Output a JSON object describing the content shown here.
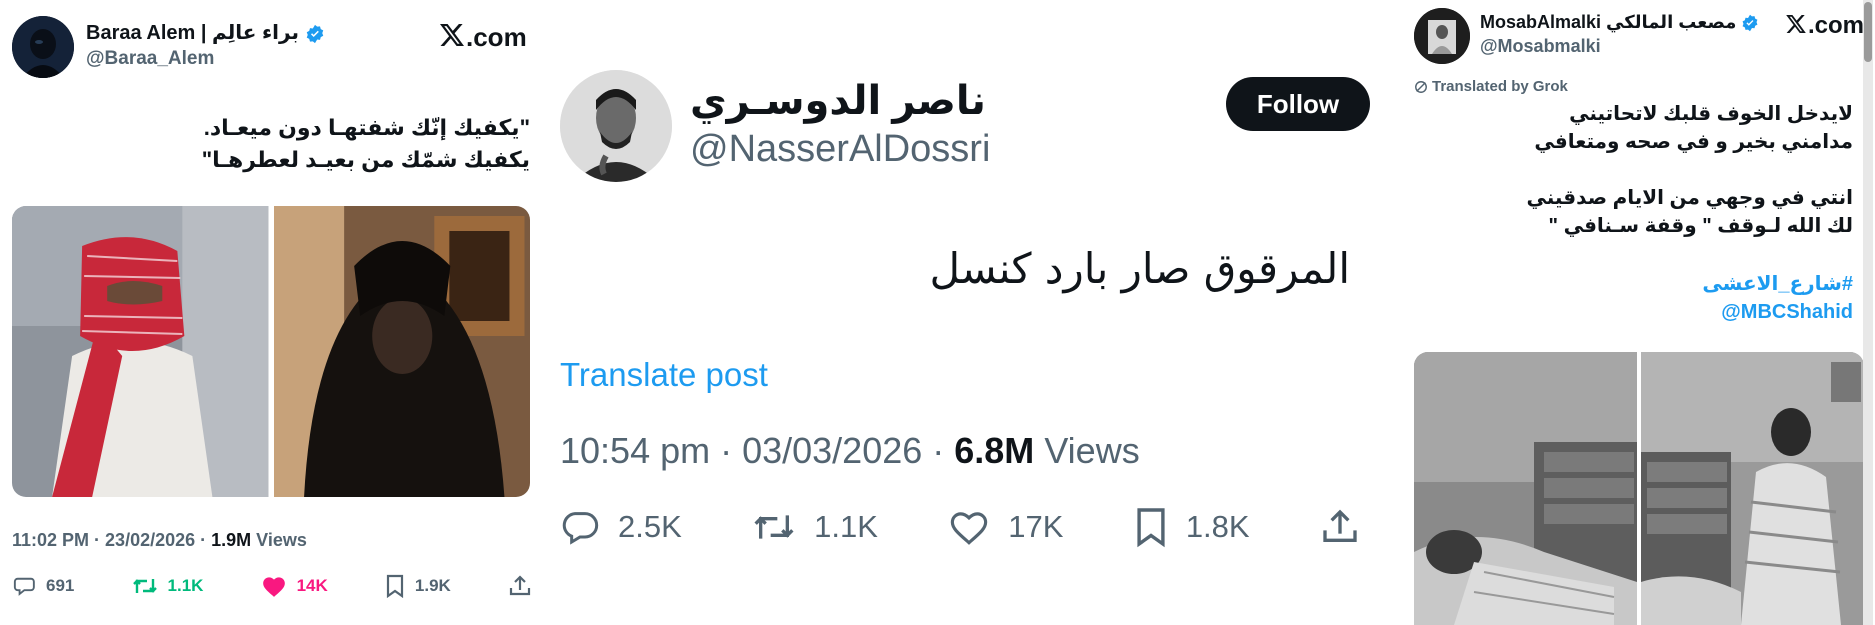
{
  "panel1": {
    "author_name": "Baraa Alem | براء عالِم",
    "handle": "@Baraa_Alem",
    "brand": "X.com",
    "text_lines": [
      "\"يكفيك إنّك شفتهـا دون ميعـاد.",
      "يكفيك شمّك من بعيـد لعطرهـا\""
    ],
    "time": "11:02 PM · 23/02/2026 · ",
    "views_count": "1.9M",
    "views_label": " Views",
    "replies": "691",
    "reposts": "1.1K",
    "likes": "14K",
    "bookmarks": "1.9K"
  },
  "panel2": {
    "author_name": "ناصر الدوسـري",
    "handle": "@NasserAlDossri",
    "follow_label": "Follow",
    "text": "المرقوق صار بارد كنسل",
    "translate_label": "Translate post",
    "time": "10:54 pm · 03/03/2026 · ",
    "views_count": "6.8M",
    "views_label": " Views",
    "replies": "2.5K",
    "reposts": "1.1K",
    "likes": "17K",
    "bookmarks": "1.8K"
  },
  "panel3": {
    "author_name": "MosabAlmalki مصعب المالكي",
    "handle": "@Mosabmalki",
    "brand": "X.com",
    "translated_label": "Translated by Grok",
    "text_lines": [
      "لايدخل الخوف قلبك لاتحاتيني",
      "مدامني بخير و في صحه ومتعافي",
      "",
      "انتي في وجهي من الايام صدقيني",
      "لك الله لـوقف \" وقفة سـنافي \""
    ],
    "hashtag": "#شارع_الاعشى",
    "mention": "@MBCShahid"
  },
  "colors": {
    "accent_blue": "#1d9bf0",
    "repost_green": "#00ba7c",
    "like_pink": "#f91880",
    "muted": "#536471",
    "text": "#0f1419"
  }
}
